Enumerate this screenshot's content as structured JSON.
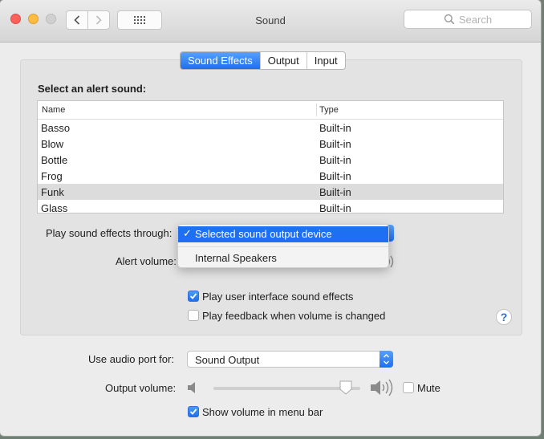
{
  "window": {
    "title": "Sound"
  },
  "search": {
    "placeholder": "Search"
  },
  "tabs": [
    {
      "label": "Sound Effects",
      "active": true
    },
    {
      "label": "Output",
      "active": false
    },
    {
      "label": "Input",
      "active": false
    }
  ],
  "alert": {
    "heading": "Select an alert sound:",
    "columns": {
      "name": "Name",
      "type": "Type"
    },
    "rows": [
      {
        "name": "Basso",
        "type": "Built-in",
        "selected": false
      },
      {
        "name": "Blow",
        "type": "Built-in",
        "selected": false
      },
      {
        "name": "Bottle",
        "type": "Built-in",
        "selected": false
      },
      {
        "name": "Frog",
        "type": "Built-in",
        "selected": false
      },
      {
        "name": "Funk",
        "type": "Built-in",
        "selected": true
      },
      {
        "name": "Glass",
        "type": "Built-in",
        "selected": false
      }
    ]
  },
  "effects": {
    "through_label": "Play sound effects through:",
    "menu": {
      "options": [
        {
          "label": "Selected sound output device",
          "checked": true
        },
        {
          "label": "Internal Speakers",
          "checked": false
        }
      ]
    },
    "alert_volume_label": "Alert volume:",
    "ui_sounds": {
      "label": "Play user interface sound effects",
      "checked": true
    },
    "feedback": {
      "label": "Play feedback when volume is changed",
      "checked": false
    }
  },
  "help": {
    "label": "?"
  },
  "audio_port": {
    "label": "Use audio port for:",
    "value": "Sound Output"
  },
  "output": {
    "label": "Output volume:",
    "level": 0.9,
    "mute": {
      "label": "Mute",
      "checked": false
    }
  },
  "menubar": {
    "label": "Show volume in menu bar",
    "checked": true
  },
  "colors": {
    "accent": "#1e6ff2",
    "selected_row": "#dcdcdc",
    "window_bg": "#ececec"
  },
  "icons": [
    "back-chevron-icon",
    "forward-chevron-icon",
    "grid-icon",
    "search-icon",
    "speaker-low-icon",
    "speaker-high-icon",
    "checkmark-icon",
    "popup-arrows-icon",
    "help-icon"
  ]
}
